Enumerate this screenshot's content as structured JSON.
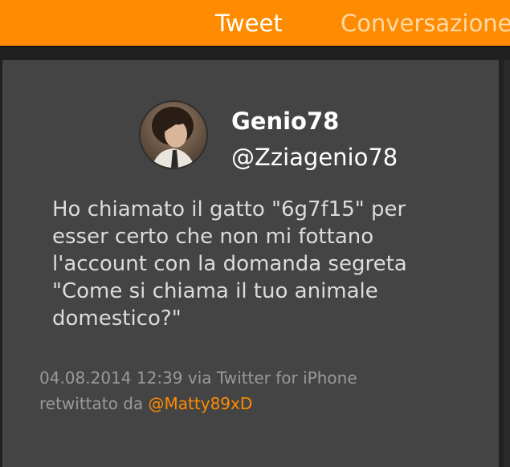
{
  "tabs": [
    {
      "label": "Tweet",
      "active": true
    },
    {
      "label": "Conversazione",
      "active": false
    }
  ],
  "colors": {
    "accent": "#ff8c00",
    "background": "#202020",
    "card": "#444444",
    "text": "#dcdcdc",
    "meta": "#9a9a9a"
  },
  "tweet": {
    "author_name": "Genio78",
    "author_handle": "@Zziagenio78",
    "text_lines": [
      "Ho chiamato il gatto \"6g7f15\" per",
      "esser certo che non mi fottano",
      "l'account con la domanda segreta",
      "\"Come si chiama il tuo animale",
      "domestico?\""
    ],
    "timestamp_source": "04.08.2014 12:39 via Twitter for iPhone",
    "retweeted_by_prefix": "retwittato da",
    "retweeted_by_user": "@Matty89xD"
  },
  "icons": {
    "avatar": "user-avatar-photo"
  }
}
